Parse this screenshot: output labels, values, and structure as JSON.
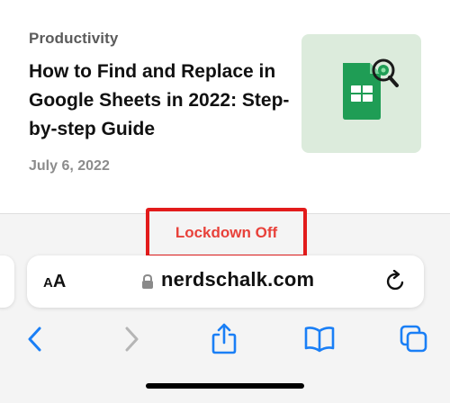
{
  "article": {
    "category": "Productivity",
    "title": "How to Find and Replace in Google Sheets in 2022: Step-by-step Guide",
    "date": "July 6, 2022",
    "thumbnail_icon": "google-sheets-search-icon"
  },
  "lockdown": {
    "label": "Lockdown Off",
    "color": "#e8413a",
    "frame_color": "#e21b1b"
  },
  "address_bar": {
    "text_size_small": "A",
    "text_size_large": "A",
    "domain": "nerdschalk.com",
    "lock_icon": "lock-icon",
    "reload_icon": "reload-icon"
  },
  "navigation": {
    "back_icon": "chevron-left-icon",
    "forward_icon": "chevron-right-icon",
    "share_icon": "share-icon",
    "bookmarks_icon": "book-icon",
    "tabs_icon": "tabs-icon",
    "accent": "#1a7ff6",
    "disabled": "#b5b5b5"
  }
}
